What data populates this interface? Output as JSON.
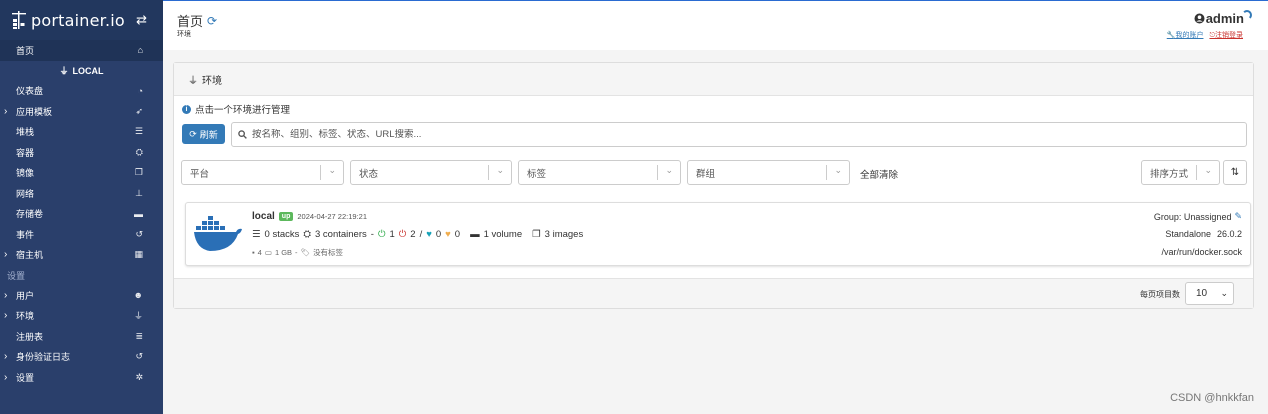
{
  "sidebar": {
    "brand": "portainer.io",
    "items_top": [
      {
        "label": "首页",
        "icon": "home-icon",
        "active": true
      }
    ],
    "endpoint": "LOCAL",
    "endpoint_items": [
      {
        "label": "仪表盘",
        "icon": "dashboard-icon",
        "caret": false
      },
      {
        "label": "应用模板",
        "icon": "rocket-icon",
        "caret": true
      },
      {
        "label": "堆栈",
        "icon": "list-icon",
        "caret": false
      },
      {
        "label": "容器",
        "icon": "cubes-icon",
        "caret": false
      },
      {
        "label": "镜像",
        "icon": "clone-icon",
        "caret": false
      },
      {
        "label": "网络",
        "icon": "sitemap-icon",
        "caret": false
      },
      {
        "label": "存储卷",
        "icon": "hdd-icon",
        "caret": false
      },
      {
        "label": "事件",
        "icon": "history-icon",
        "caret": false
      },
      {
        "label": "宿主机",
        "icon": "th-icon",
        "caret": true
      }
    ],
    "settings_heading": "设置",
    "settings_items": [
      {
        "label": "用户",
        "icon": "users-icon",
        "caret": true
      },
      {
        "label": "环境",
        "icon": "plug-icon",
        "caret": true
      },
      {
        "label": "注册表",
        "icon": "database-icon",
        "caret": false
      },
      {
        "label": "身份验证日志",
        "icon": "history-icon",
        "caret": true
      },
      {
        "label": "设置",
        "icon": "cogs-icon",
        "caret": true
      }
    ]
  },
  "header": {
    "title": "首页",
    "breadcrumb": "环境",
    "user": "admin",
    "my_account": "我的账户",
    "logout": "注销登录"
  },
  "panel": {
    "title": "环境",
    "hint": "点击一个环境进行管理",
    "refresh_label": "刷新",
    "search_placeholder": "按名称、组别、标签、状态、URL搜索...",
    "filters": [
      "平台",
      "状态",
      "标签",
      "群组"
    ],
    "clear_all": "全部清除",
    "sort_label": "排序方式",
    "page_size_label": "每页项目数",
    "page_size": "10"
  },
  "environment": {
    "name": "local",
    "status": "up",
    "timestamp": "2024-04-27 22:19:21",
    "stacks": "0 stacks",
    "containers": "3 containers",
    "healthy_running": "1",
    "stopped": "2",
    "healthy": "0",
    "unhealthy": "0",
    "volumes": "1 volume",
    "images": "3 images",
    "cpu": "4",
    "memory": "1 GB",
    "tags": "没有标签",
    "group": "Group: Unassigned",
    "mode": "Standalone",
    "version": "26.0.2",
    "socket": "/var/run/docker.sock"
  },
  "watermark": "CSDN @hnkkfan",
  "colors": {
    "sidebar_bg": "#2a3f6b",
    "primary": "#337ab7",
    "up_badge": "#5cb85c"
  }
}
